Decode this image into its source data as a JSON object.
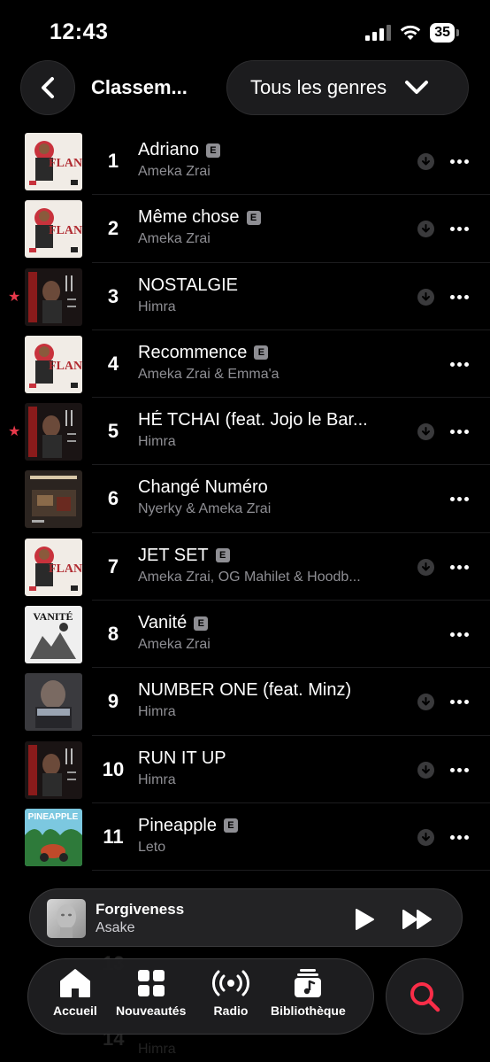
{
  "status": {
    "time": "12:43",
    "battery": "35"
  },
  "header": {
    "title": "Classem...",
    "genre_filter": "Tous les genres"
  },
  "tracks": [
    {
      "rank": "1",
      "title": "Adriano",
      "explicit": true,
      "artist": "Ameka Zrai",
      "starred": false,
      "download": true,
      "art": "flan"
    },
    {
      "rank": "2",
      "title": "Même chose",
      "explicit": true,
      "artist": "Ameka Zrai",
      "starred": false,
      "download": true,
      "art": "flan"
    },
    {
      "rank": "3",
      "title": "NOSTALGIE",
      "explicit": false,
      "artist": "Himra",
      "starred": true,
      "download": true,
      "art": "himra"
    },
    {
      "rank": "4",
      "title": "Recommence",
      "explicit": true,
      "artist": "Ameka Zrai & Emma'a",
      "starred": false,
      "download": false,
      "art": "flan"
    },
    {
      "rank": "5",
      "title": "HÉ TCHAI (feat. Jojo le Bar...",
      "explicit": false,
      "artist": "Himra",
      "starred": true,
      "download": true,
      "art": "himra"
    },
    {
      "rank": "6",
      "title": "Changé Numéro",
      "explicit": false,
      "artist": "Nyerky & Ameka Zrai",
      "starred": false,
      "download": false,
      "art": "change"
    },
    {
      "rank": "7",
      "title": "JET SET",
      "explicit": true,
      "artist": "Ameka Zrai, OG Mahilet & Hoodb...",
      "starred": false,
      "download": true,
      "art": "flan"
    },
    {
      "rank": "8",
      "title": "Vanité",
      "explicit": true,
      "artist": "Ameka Zrai",
      "starred": false,
      "download": false,
      "art": "vanite"
    },
    {
      "rank": "9",
      "title": "NUMBER ONE (feat. Minz)",
      "explicit": false,
      "artist": "Himra",
      "starred": false,
      "download": true,
      "art": "number"
    },
    {
      "rank": "10",
      "title": "RUN IT UP",
      "explicit": false,
      "artist": "Himra",
      "starred": false,
      "download": true,
      "art": "himra"
    },
    {
      "rank": "11",
      "title": "Pineapple",
      "explicit": true,
      "artist": "Leto",
      "starred": false,
      "download": true,
      "art": "pineapple"
    }
  ],
  "art_text": {
    "flan": "FLAN",
    "vanite": "VANITÉ",
    "pineapple": "PINEAPPLE"
  },
  "behind": {
    "rank_13": "13",
    "rank_14": "14",
    "artist_14": "Himra"
  },
  "now_playing": {
    "title": "Forgiveness",
    "artist": "Asake"
  },
  "tabs": [
    {
      "label": "Accueil",
      "icon": "home-icon"
    },
    {
      "label": "Nouveautés",
      "icon": "grid-icon"
    },
    {
      "label": "Radio",
      "icon": "radio-icon"
    },
    {
      "label": "Bibliothèque",
      "icon": "library-icon"
    }
  ],
  "colors": {
    "accent": "#fa2d48",
    "star": "#e8394b",
    "background": "#000000"
  }
}
